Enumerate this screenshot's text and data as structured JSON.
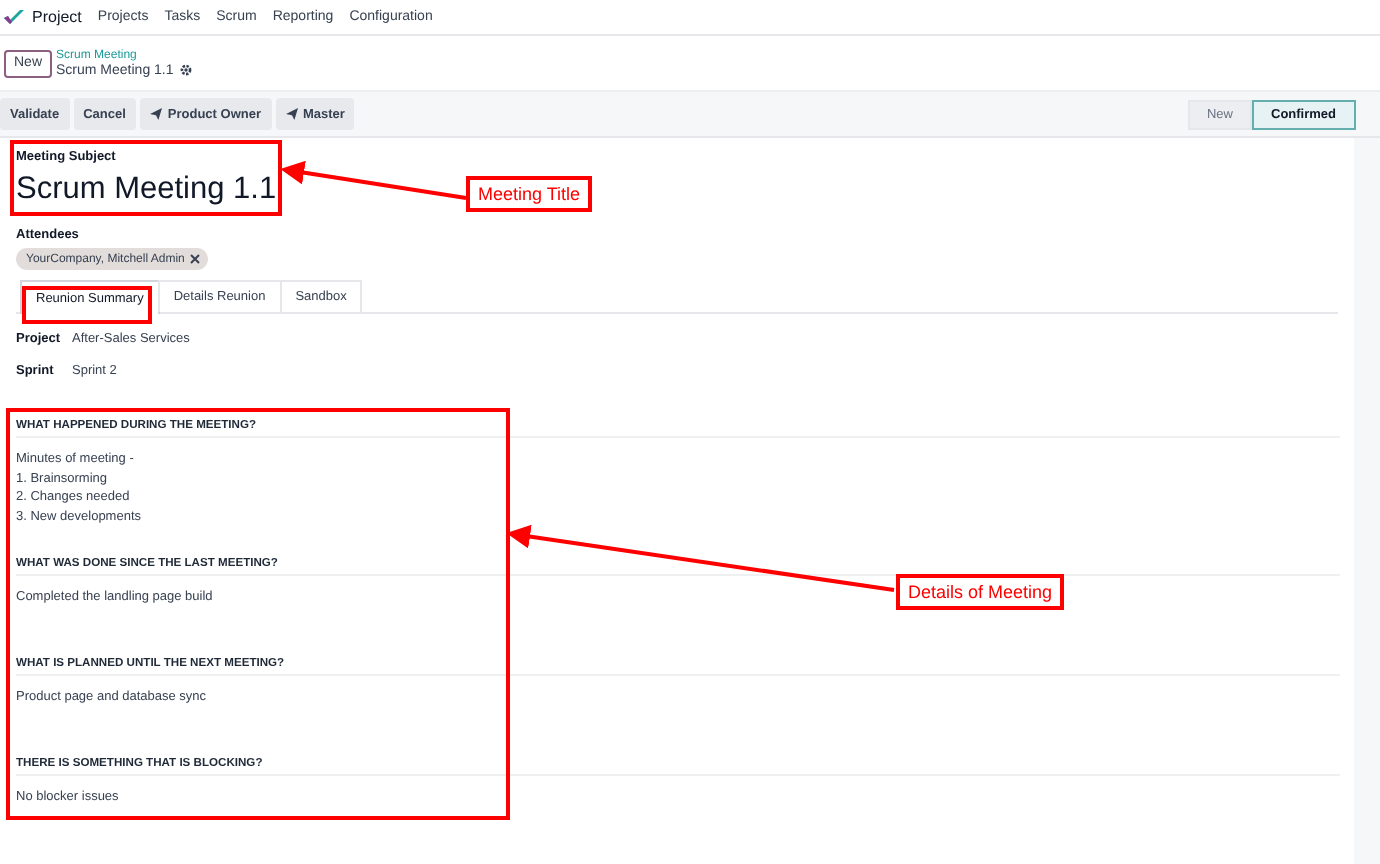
{
  "navbar": {
    "app": "Project",
    "menu": [
      "Projects",
      "Tasks",
      "Scrum",
      "Reporting",
      "Configuration"
    ]
  },
  "control_panel": {
    "new_button": "New",
    "breadcrumb": "Scrum Meeting",
    "record": "Scrum Meeting 1.1"
  },
  "actions": [
    {
      "label": "Validate",
      "kind": "plain"
    },
    {
      "label": "Cancel",
      "kind": "plain"
    },
    {
      "label": "Product Owner",
      "kind": "send"
    },
    {
      "label": "Master",
      "kind": "send"
    }
  ],
  "stages": [
    {
      "label": "New",
      "selected": false
    },
    {
      "label": "Confirmed",
      "selected": true
    }
  ],
  "form": {
    "subject_label": "Meeting Subject",
    "subject": "Scrum Meeting 1.1",
    "attendees_label": "Attendees",
    "attendees": [
      "YourCompany, Mitchell Admin"
    ]
  },
  "tabs": [
    {
      "label": "Reunion Summary",
      "selected": true
    },
    {
      "label": "Details Reunion",
      "selected": false
    },
    {
      "label": "Sandbox",
      "selected": false
    }
  ],
  "fields": [
    {
      "label": "Project",
      "value": "After-Sales Services"
    },
    {
      "label": "Sprint",
      "value": "Sprint 2"
    }
  ],
  "sections": [
    {
      "heading": "WHAT HAPPENED DURING THE MEETING?",
      "lines": [
        "Minutes of meeting -",
        "1. Brainsorming",
        "2. Changes needed",
        "3. New developments"
      ]
    },
    {
      "heading": "WHAT WAS DONE SINCE THE LAST MEETING?",
      "lines": [
        "Completed the landling page build"
      ]
    },
    {
      "heading": "WHAT IS PLANNED UNTIL THE NEXT MEETING?",
      "lines": [
        "Product page and database sync"
      ]
    },
    {
      "heading": "THERE IS SOMETHING THAT IS BLOCKING?",
      "lines": [
        "No blocker issues"
      ]
    }
  ],
  "annotations": [
    {
      "label": "Meeting Title"
    },
    {
      "label": "Details of Meeting"
    }
  ]
}
